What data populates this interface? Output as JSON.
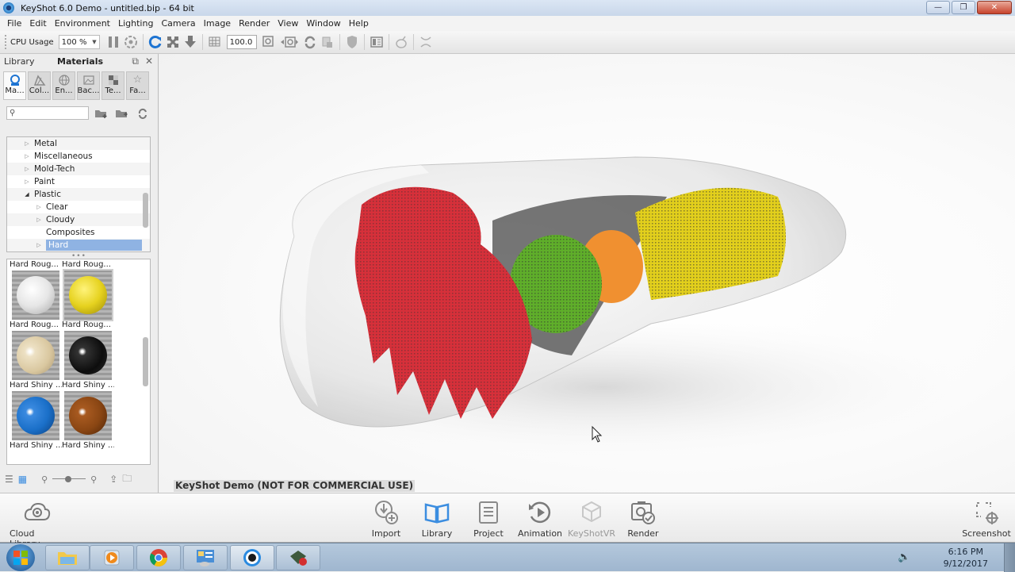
{
  "window": {
    "title": "KeyShot 6.0 Demo  - untitled.bip  - 64 bit",
    "controls": {
      "minimize": "—",
      "restore": "❐",
      "close": "✕"
    }
  },
  "menu": [
    "File",
    "Edit",
    "Environment",
    "Lighting",
    "Camera",
    "Image",
    "Render",
    "View",
    "Window",
    "Help"
  ],
  "toolbar": {
    "cpu_label": "CPU Usage",
    "cpu_value": "100 %",
    "resolution_value": "100.0",
    "icons": [
      "pause-icon",
      "performance-mode-icon",
      "refresh-icon",
      "fullscreen-icon",
      "download-icon",
      "region-icon",
      "zoom-fit-icon",
      "camera-prev-icon",
      "camera-next-icon",
      "rotate-icon",
      "lock-icon",
      "shield-icon",
      "layout-icon",
      "material-icon",
      "scatter-icon"
    ]
  },
  "library": {
    "panel_label": "Library",
    "panel_title": "Materials",
    "tabs": [
      {
        "label": "Ma...",
        "icon": "materials-icon",
        "active": true
      },
      {
        "label": "Col...",
        "icon": "colors-icon",
        "active": false
      },
      {
        "label": "En...",
        "icon": "environments-icon",
        "active": false
      },
      {
        "label": "Bac...",
        "icon": "backplates-icon",
        "active": false
      },
      {
        "label": "Te...",
        "icon": "textures-icon",
        "active": false
      },
      {
        "label": "Fa...",
        "icon": "favorites-icon",
        "active": false
      }
    ],
    "search_placeholder": "",
    "tree": [
      {
        "label": "Metal",
        "level": 1,
        "arrow": "▷",
        "selected": false
      },
      {
        "label": "Miscellaneous",
        "level": 1,
        "arrow": "▷",
        "selected": false
      },
      {
        "label": "Mold-Tech",
        "level": 1,
        "arrow": "▷",
        "selected": false
      },
      {
        "label": "Paint",
        "level": 1,
        "arrow": "▷",
        "selected": false
      },
      {
        "label": "Plastic",
        "level": 1,
        "arrow": "◢",
        "selected": false
      },
      {
        "label": "Clear",
        "level": 2,
        "arrow": "▷",
        "selected": false
      },
      {
        "label": "Cloudy",
        "level": 2,
        "arrow": "▷",
        "selected": false
      },
      {
        "label": "Composites",
        "level": 2,
        "arrow": "",
        "selected": false
      },
      {
        "label": "Hard",
        "level": 2,
        "arrow": "▷",
        "selected": true
      }
    ],
    "materials": [
      {
        "label": "Hard Roug...",
        "color": "",
        "selected": false,
        "header_only": true
      },
      {
        "label": "Hard Roug...",
        "color": "",
        "selected": false,
        "header_only": true
      },
      {
        "label": "Hard Roug...",
        "color": "#f2f2f2",
        "selected": false
      },
      {
        "label": "Hard Roug...",
        "color": "#e6d21f",
        "selected": true
      },
      {
        "label": "Hard Shiny ...",
        "color": "#e3d3b1",
        "selected": false
      },
      {
        "label": "Hard Shiny ...",
        "color": "#111111",
        "selected": false
      },
      {
        "label": "Hard Shiny ...",
        "color": "#1a6fc8",
        "selected": false
      },
      {
        "label": "Hard Shiny ...",
        "color": "#8a4613",
        "selected": false
      }
    ]
  },
  "viewport": {
    "watermark": "KeyShot Demo (NOT FOR COMMERCIAL USE)",
    "model_colors": {
      "fan": "#d6303a",
      "compressor": "#5fae2a",
      "combustor": "#f09030",
      "turbine": "#e2cf1c",
      "shell": "#d9d9d9"
    }
  },
  "ribbon": {
    "cloud_library": "Cloud Library",
    "buttons": [
      {
        "label": "Import",
        "icon": "import-icon",
        "disabled": false
      },
      {
        "label": "Library",
        "icon": "library-book-icon",
        "disabled": false
      },
      {
        "label": "Project",
        "icon": "project-icon",
        "disabled": false
      },
      {
        "label": "Animation",
        "icon": "animation-icon",
        "disabled": false
      },
      {
        "label": "KeyShotVR",
        "icon": "keyshotvr-icon",
        "disabled": true
      },
      {
        "label": "Render",
        "icon": "render-icon",
        "disabled": false
      }
    ],
    "screenshot": "Screenshot"
  },
  "taskbar": {
    "apps": [
      "file-explorer-icon",
      "media-player-icon",
      "chrome-icon",
      "control-panel-icon",
      "keyshot-icon",
      "camtasia-recorder-icon"
    ],
    "time": "6:16 PM",
    "date": "9/12/2017"
  }
}
